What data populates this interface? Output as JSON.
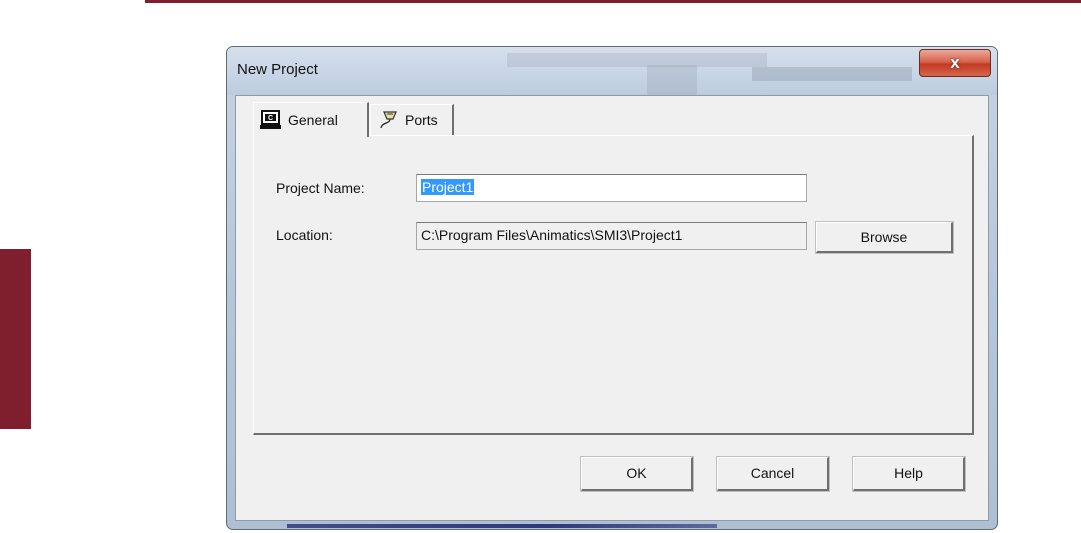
{
  "window": {
    "title": "New Project",
    "close_glyph": "x"
  },
  "tabs": [
    {
      "label": "General",
      "icon": "computer-monitor-icon",
      "selected": true
    },
    {
      "label": "Ports",
      "icon": "serial-cable-icon",
      "selected": false
    }
  ],
  "general": {
    "project_name_label": "Project Name:",
    "project_name_value": "Project1",
    "location_label": "Location:",
    "location_value": "C:\\Program Files\\Animatics\\SMI3\\Project1",
    "browse_label": "Browse"
  },
  "buttons": {
    "ok_label": "OK",
    "cancel_label": "Cancel",
    "help_label": "Help"
  },
  "colors": {
    "accent": "#7f1f2e",
    "selection": "#3399ff",
    "close_button": "#c33b22"
  }
}
